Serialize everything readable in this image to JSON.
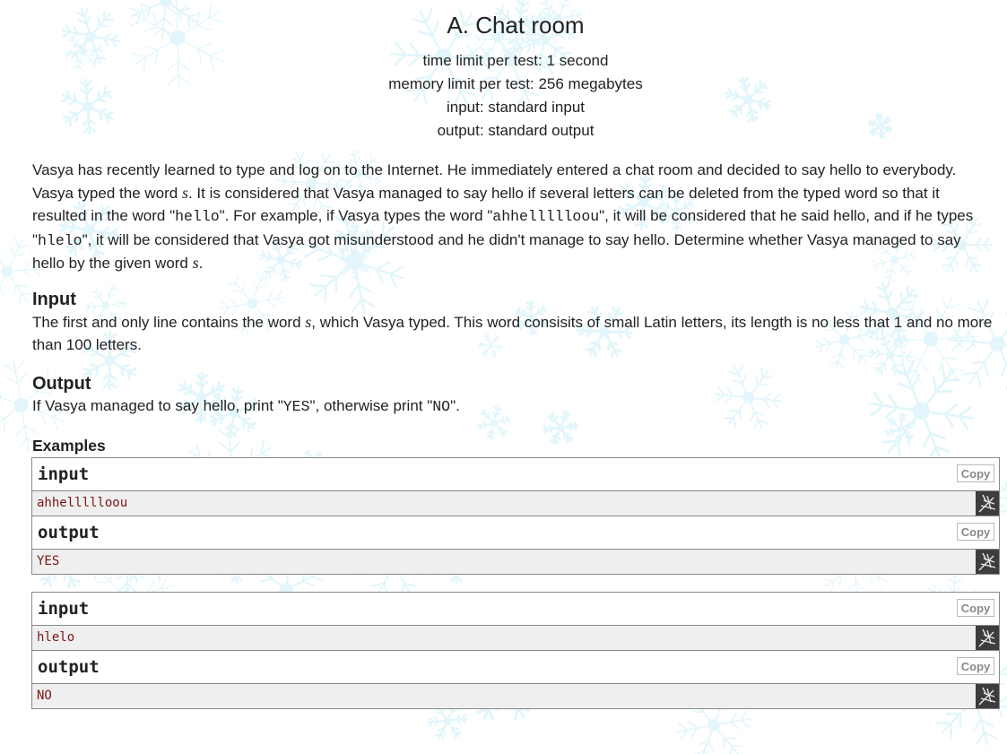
{
  "problem": {
    "title": "A. Chat room",
    "time_limit": "time limit per test: 1 second",
    "memory_limit": "memory limit per test: 256 megabytes",
    "input_file": "input: standard input",
    "output_file": "output: standard output"
  },
  "statement": {
    "p1": "Vasya has recently learned to type and log on to the Internet. He immediately entered a chat room and decided to say hello to everybody. Vasya typed the word ",
    "var_s": "s",
    "p2": ". It is considered that Vasya managed to say hello if several letters can be deleted from the typed word so that it resulted in the word \"",
    "code_hello": "hello",
    "p3": "\". For example, if Vasya types the word \"",
    "code_example1": "ahhellllloou",
    "p4": "\", it will be considered that he said hello, and if he types \"",
    "code_example2": "hlelo",
    "p5": "\", it will be considered that Vasya got misunderstood and he didn't manage to say hello. Determine whether Vasya managed to say hello by the given word ",
    "p6": "."
  },
  "input_section": {
    "title": "Input",
    "t1": "The first and only line contains the word ",
    "t2": ", which Vasya typed. This word consisits of small Latin letters, its length is no less that 1 and no more than 100 letters."
  },
  "output_section": {
    "title": "Output",
    "t1": "If Vasya managed to say hello, print \"",
    "yes": "YES",
    "t2": "\", otherwise print \"",
    "no": "NO",
    "t3": "\"."
  },
  "examples": {
    "title": "Examples",
    "input_label": "input",
    "output_label": "output",
    "copy_label": "Copy",
    "items": [
      {
        "input": "ahhellllloou",
        "output": "YES"
      },
      {
        "input": "hlelo",
        "output": "NO"
      }
    ]
  },
  "colors": {
    "background_snow": "#d8f3fa",
    "text": "#222222",
    "example_text": "#7a1616",
    "example_body_bg": "#efefef",
    "border": "#888888"
  },
  "icons": {
    "copy_to_editor": "pen-icon"
  }
}
